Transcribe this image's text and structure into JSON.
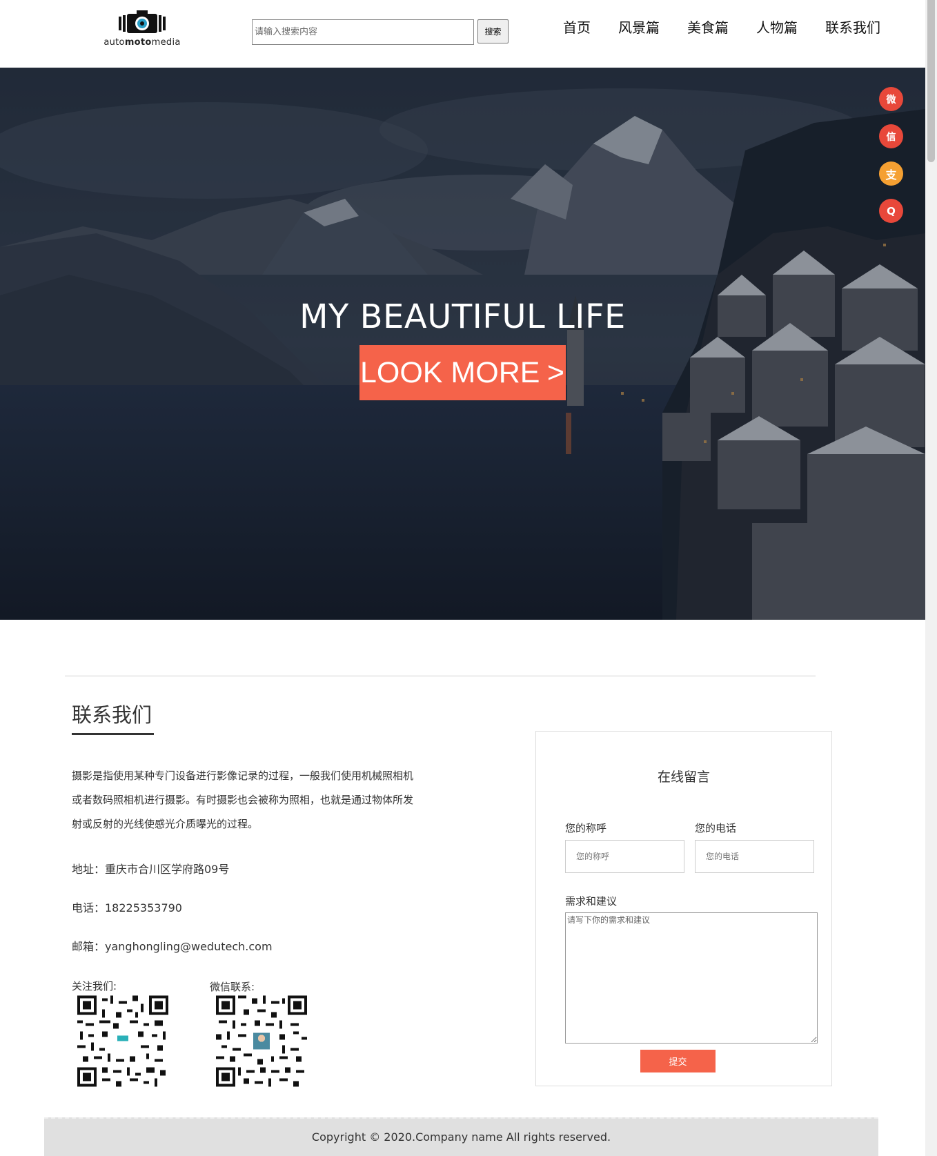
{
  "header": {
    "logo": {
      "text_a": "auto",
      "text_b": "moto",
      "text_c": "media"
    },
    "search": {
      "placeholder": "请输入搜索内容",
      "button_label": "搜索"
    },
    "nav": [
      {
        "label": "首页"
      },
      {
        "label": "风景篇"
      },
      {
        "label": "美食篇"
      },
      {
        "label": "人物篇"
      },
      {
        "label": "联系我们"
      }
    ]
  },
  "hero": {
    "title": "MY BEAUTIFUL LIFE",
    "button_label": "LOOK MORE",
    "button_arrow": ">",
    "social": [
      {
        "icon": "weibo-icon",
        "glyph": "微",
        "color": "#e8483a"
      },
      {
        "icon": "wechat-icon",
        "glyph": "信",
        "color": "#e8483a"
      },
      {
        "icon": "alipay-icon",
        "glyph": "支",
        "color": "#f5a032"
      },
      {
        "icon": "qq-icon",
        "glyph": "Q",
        "color": "#e8483a"
      }
    ]
  },
  "contact": {
    "title": "联系我们",
    "description": "摄影是指使用某种专门设备进行影像记录的过程，一般我们使用机械照相机或者数码照相机进行摄影。有时摄影也会被称为照相，也就是通过物体所发射或反射的光线使感光介质曝光的过程。",
    "address": "地址：重庆市合川区学府路09号",
    "phone": "电话：18225353790",
    "email": "邮箱：yanghongling@wedutech.com",
    "follow_label": "关注我们:",
    "wechat_label": "微信联系:"
  },
  "form": {
    "title": "在线留言",
    "name_label": "您的称呼",
    "name_placeholder": "您的称呼",
    "phone_label": "您的电话",
    "phone_placeholder": "您的电话",
    "message_label": "需求和建议",
    "message_placeholder": "请写下你的需求和建议",
    "submit_label": "提交"
  },
  "footer": {
    "copyright": "Copyright © 2020.Company name All rights reserved."
  },
  "colors": {
    "accent": "#f5634a"
  }
}
